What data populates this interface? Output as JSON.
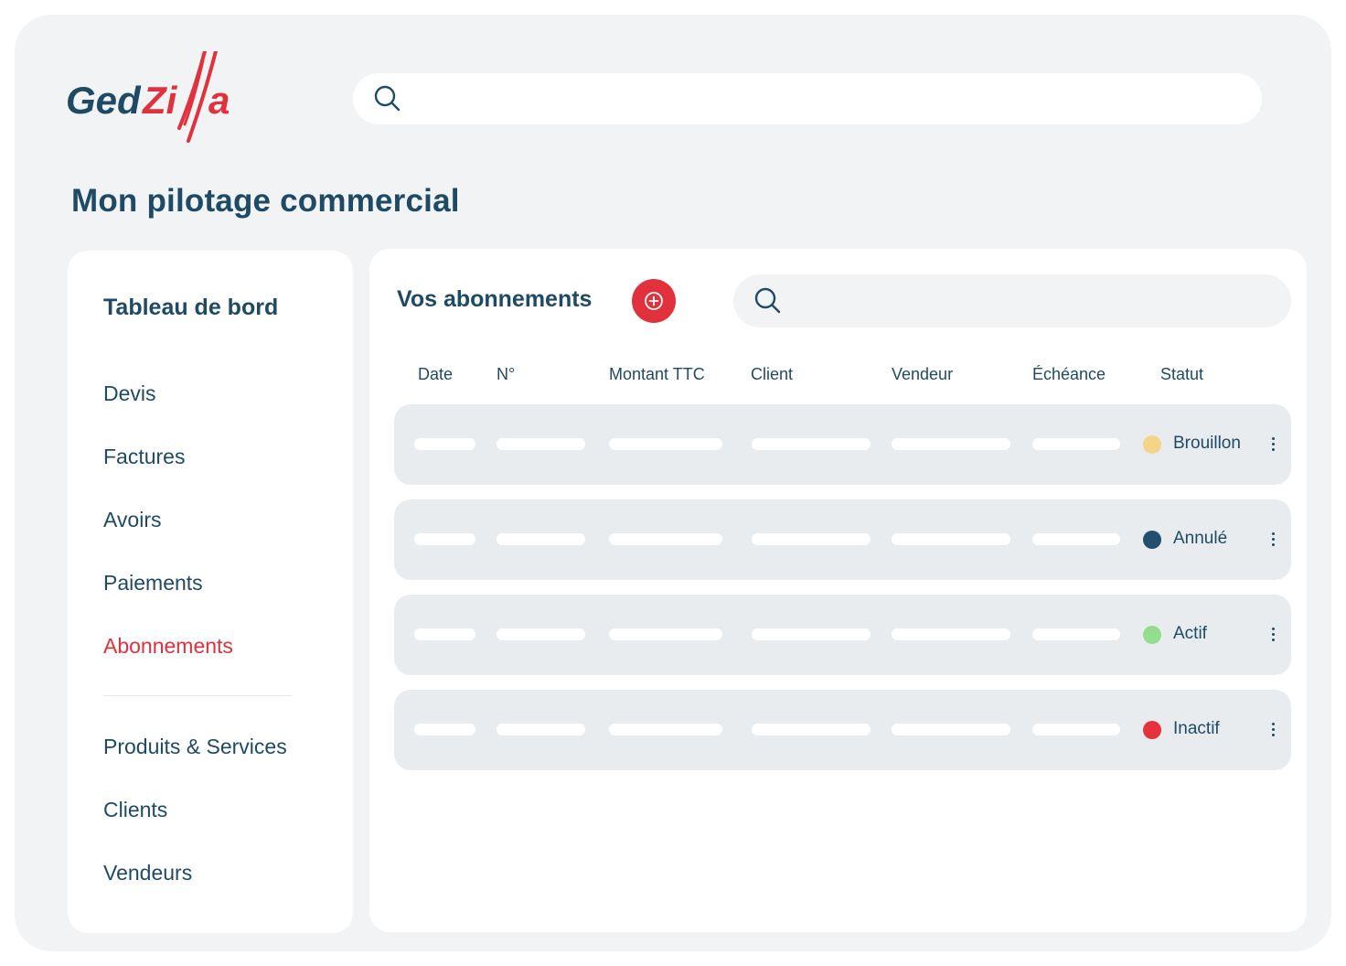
{
  "brand": {
    "name_part1": "Ged",
    "name_part2": "Zi",
    "name_part3": "a",
    "colors": {
      "primary": "#1e4a66",
      "accent": "#e0313d"
    }
  },
  "header": {
    "search_icon": "search-icon",
    "search_placeholder": ""
  },
  "page_title": "Mon pilotage commercial",
  "sidebar": {
    "heading": "Tableau de bord",
    "items": [
      {
        "label": "Devis",
        "active": false
      },
      {
        "label": "Factures",
        "active": false
      },
      {
        "label": "Avoirs",
        "active": false
      },
      {
        "label": "Paiements",
        "active": false
      },
      {
        "label": "Abonnements",
        "active": true
      }
    ],
    "secondary_items": [
      {
        "label": "Produits & Services"
      },
      {
        "label": "Clients"
      },
      {
        "label": "Vendeurs"
      }
    ]
  },
  "main": {
    "title": "Vos abonnements",
    "add_icon": "plus-circle-icon",
    "search_icon": "search-icon",
    "search_placeholder": "",
    "columns": [
      "Date",
      "N°",
      "Montant TTC",
      "Client",
      "Vendeur",
      "Échéance",
      "Statut"
    ],
    "rows": [
      {
        "status": "Brouillon",
        "status_color": "#f4d488",
        "menu_icon": "more-vertical-icon"
      },
      {
        "status": "Annulé",
        "status_color": "#234e6d",
        "menu_icon": "more-vertical-icon"
      },
      {
        "status": "Actif",
        "status_color": "#92de8c",
        "menu_icon": "more-vertical-icon"
      },
      {
        "status": "Inactif",
        "status_color": "#e6323e",
        "menu_icon": "more-vertical-icon"
      }
    ]
  }
}
